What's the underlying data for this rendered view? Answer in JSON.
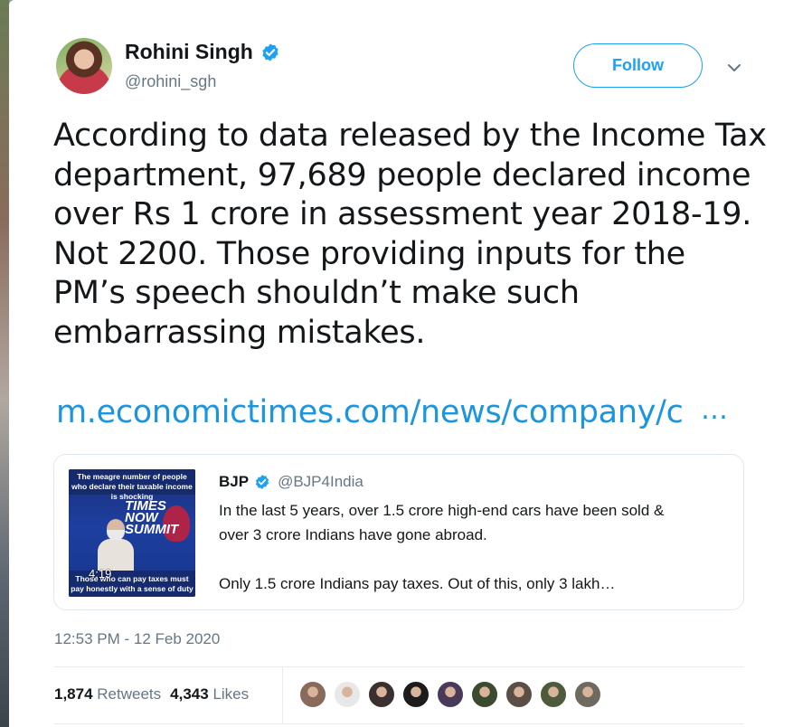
{
  "tweet": {
    "author": {
      "name": "Rohini Singh",
      "handle": "@rohini_sgh",
      "avatar_icon": "avatar-photo",
      "verified": true
    },
    "follow_label": "Follow",
    "menu_icon": "chevron-down-icon",
    "text": "According to data released by the Income Tax\ndepartment, 97,689 people declared income\nover Rs 1 crore in assessment year 2018-19.\nNot 2200. Those providing inputs for the\nPM’s speech shouldn’t make such\nembarrassing mistakes.",
    "link": "m.economictimes.com/news/company/c",
    "link_ellipsis": "…",
    "quoted": {
      "name": "BJP",
      "handle": "@BJP4India",
      "verified": true,
      "text": "In the last 5 years, over 1.5 crore high-end cars have been sold &\nover 3 crore Indians have gone abroad.\n\nOnly 1.5 crore Indians pay taxes. Out of this, only 3 lakh…",
      "thumbnail": {
        "top_caption": "The meagre number of people who declare their taxable income is shocking",
        "bottom_caption": "Those who can pay taxes must pay honestly with a sense of duty",
        "mid_text": "TIMES NOW SUMMIT",
        "duration": "4:19"
      }
    },
    "timestamp": "12:53 PM - 12 Feb 2020",
    "stats": {
      "retweets_count": "1,874",
      "retweets_label": "Retweets",
      "likes_count": "4,343",
      "likes_label": "Likes"
    },
    "liker_avatar_colors": [
      "#8a6a5a",
      "#e8e8e8",
      "#3a3030",
      "#1c1c1c",
      "#4a3a5a",
      "#3c4a30",
      "#5a4e46",
      "#4e5a3c",
      "#6e6a62"
    ]
  },
  "colors": {
    "accent": "#1da1f2",
    "link": "#1b95e0",
    "secondary_text": "#657786",
    "primary_text": "#14171a"
  }
}
